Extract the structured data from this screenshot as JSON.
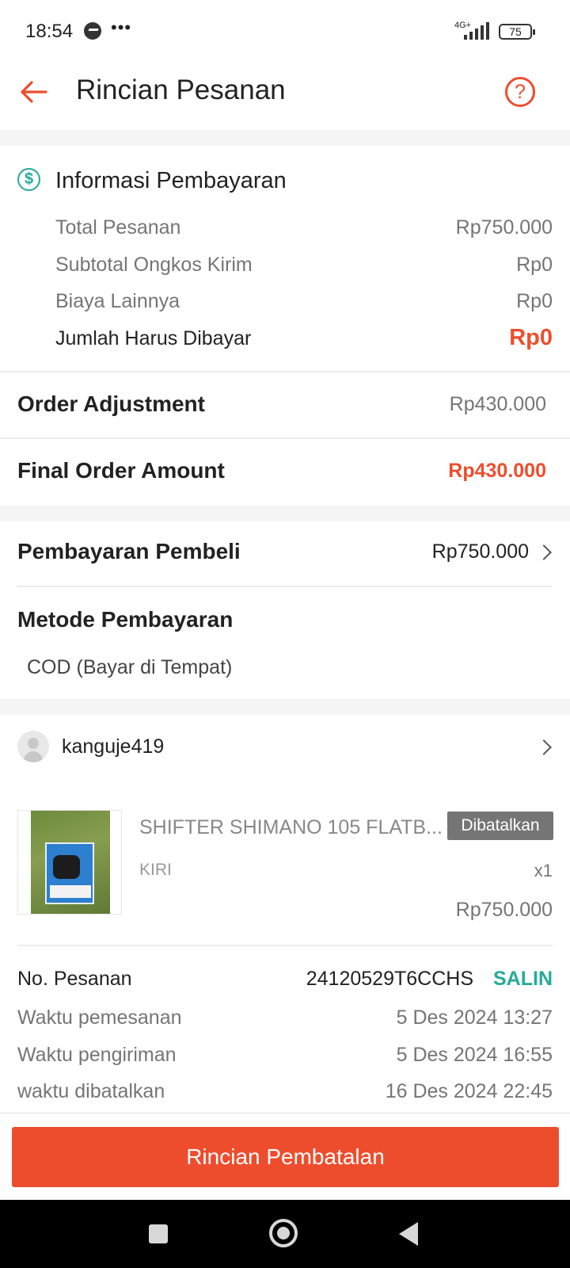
{
  "status_bar": {
    "time": "18:54",
    "network": "4G+",
    "battery": "75"
  },
  "header": {
    "title": "Rincian Pesanan"
  },
  "payment_info": {
    "title": "Informasi Pembayaran",
    "rows": [
      {
        "label": "Total Pesanan",
        "value": "Rp750.000"
      },
      {
        "label": "Subtotal Ongkos Kirim",
        "value": "Rp0"
      },
      {
        "label": "Biaya Lainnya",
        "value": "Rp0"
      },
      {
        "label": "Jumlah Harus Dibayar",
        "value": "Rp0"
      }
    ]
  },
  "order_adjustment": {
    "label": "Order Adjustment",
    "value": "Rp430.000"
  },
  "final_order_amount": {
    "label": "Final Order Amount",
    "value": "Rp430.000"
  },
  "buyer_payment": {
    "label": "Pembayaran Pembeli",
    "value": "Rp750.000"
  },
  "payment_method": {
    "label": "Metode Pembayaran",
    "value": "COD (Bayar di Tempat)"
  },
  "buyer": {
    "username": "kanguje419"
  },
  "product": {
    "name": "SHIFTER SHIMANO 105 FLATB...",
    "status": "Dibatalkan",
    "variant": "KIRI",
    "quantity": "x1",
    "price": "Rp750.000"
  },
  "order_details": {
    "order_no_label": "No. Pesanan",
    "order_no": "24120529T6CCHS",
    "copy_label": "SALIN",
    "rows": [
      {
        "label": "Waktu pemesanan",
        "value": "5 Des 2024 13:27"
      },
      {
        "label": "Waktu pengiriman",
        "value": "5 Des 2024 16:55"
      },
      {
        "label": "waktu dibatalkan",
        "value": "16 Des 2024 22:45"
      }
    ]
  },
  "bottom_button": {
    "label": "Rincian Pembatalan"
  },
  "colors": {
    "accent": "#ee4d2d",
    "teal": "#26aa99",
    "badge_gray": "#757575"
  },
  "icons": [
    "messenger-icon",
    "signal-icon",
    "battery-icon",
    "back-arrow-icon",
    "help-icon",
    "dollar-icon",
    "chevron-right-icon",
    "avatar-icon",
    "nav-square-icon",
    "nav-home-icon",
    "nav-back-icon"
  ]
}
